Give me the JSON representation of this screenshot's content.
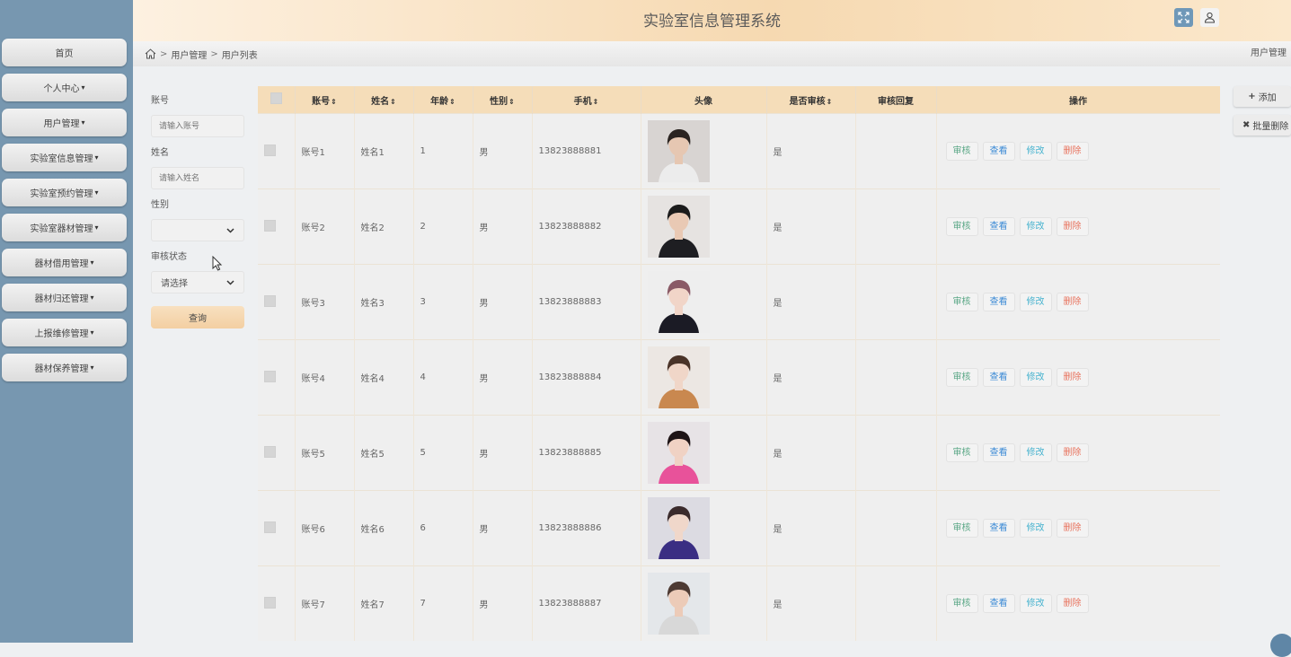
{
  "app": {
    "title": "实验室信息管理系统"
  },
  "sidebar": {
    "items": [
      {
        "label": "首页",
        "caret": ""
      },
      {
        "label": "个人中心",
        "caret": "▾"
      },
      {
        "label": "用户管理",
        "caret": "▾"
      },
      {
        "label": "实验室信息管理",
        "caret": "▾"
      },
      {
        "label": "实验室预约管理",
        "caret": "▾"
      },
      {
        "label": "实验室器材管理",
        "caret": "▾"
      },
      {
        "label": "器材借用管理",
        "caret": "▾"
      },
      {
        "label": "器材归还管理",
        "caret": "▾"
      },
      {
        "label": "上报维修管理",
        "caret": "▾"
      },
      {
        "label": "器材保养管理",
        "caret": "▾"
      }
    ]
  },
  "breadcrumb": {
    "sep": ">",
    "items": [
      "用户管理",
      "用户列表"
    ],
    "right": "用户管理"
  },
  "search": {
    "account_label": "账号",
    "account_placeholder": "请输入账号",
    "name_label": "姓名",
    "name_placeholder": "请输入姓名",
    "gender_label": "性别",
    "gender_value": "",
    "status_label": "审核状态",
    "status_value": "请选择",
    "query_label": "查询"
  },
  "table": {
    "sort_glyph": "⇕",
    "columns": [
      "账号",
      "姓名",
      "年龄",
      "性别",
      "手机",
      "头像",
      "是否审核",
      "审核回复",
      "操作"
    ],
    "rows": [
      {
        "account": "账号1",
        "name": "姓名1",
        "age": "1",
        "gender": "男",
        "phone": "13823888881",
        "approved": "是",
        "reply": ""
      },
      {
        "account": "账号2",
        "name": "姓名2",
        "age": "2",
        "gender": "男",
        "phone": "13823888882",
        "approved": "是",
        "reply": ""
      },
      {
        "account": "账号3",
        "name": "姓名3",
        "age": "3",
        "gender": "男",
        "phone": "13823888883",
        "approved": "是",
        "reply": ""
      },
      {
        "account": "账号4",
        "name": "姓名4",
        "age": "4",
        "gender": "男",
        "phone": "13823888884",
        "approved": "是",
        "reply": ""
      },
      {
        "account": "账号5",
        "name": "姓名5",
        "age": "5",
        "gender": "男",
        "phone": "13823888885",
        "approved": "是",
        "reply": ""
      },
      {
        "account": "账号6",
        "name": "姓名6",
        "age": "6",
        "gender": "男",
        "phone": "13823888886",
        "approved": "是",
        "reply": ""
      },
      {
        "account": "账号7",
        "name": "姓名7",
        "age": "7",
        "gender": "男",
        "phone": "13823888887",
        "approved": "是",
        "reply": ""
      }
    ],
    "actions": {
      "review": "审核",
      "view": "查看",
      "edit": "修改",
      "delete": "删除"
    }
  },
  "toolbar": {
    "add_label": "添加",
    "batch_delete_label": "批量删除"
  },
  "colors": {
    "sidebar": "#7797b0",
    "accent": "#f5ddb9",
    "review": "#5aa786",
    "view": "#3d8bd6",
    "edit": "#48b3cf",
    "delete": "#e8735e"
  }
}
